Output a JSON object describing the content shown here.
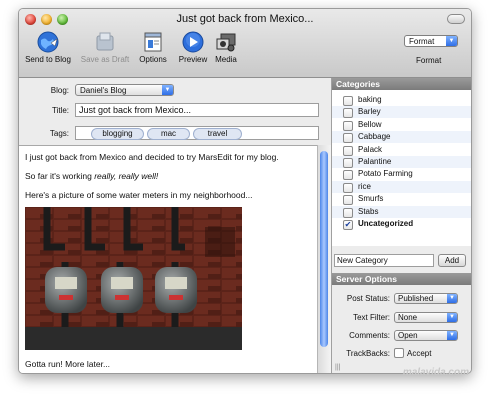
{
  "window": {
    "title": "Just got back from Mexico..."
  },
  "toolbar": {
    "send_label": "Send to Blog",
    "draft_label": "Save as Draft",
    "options_label": "Options",
    "preview_label": "Preview",
    "media_label": "Media",
    "format_value": "Format",
    "format_label": "Format"
  },
  "fields": {
    "blog_label": "Blog:",
    "blog_value": "Daniel's Blog",
    "title_label": "Title:",
    "title_value": "Just got back from Mexico...",
    "tags_label": "Tags:",
    "tags": [
      "blogging",
      "mac",
      "travel"
    ]
  },
  "body": {
    "line1": "I just got back from Mexico and decided to try MarsEdit for my blog.",
    "line2_prefix": "So far it's working ",
    "line2_italic": "really, really well!",
    "line3": "Here's a picture of some water meters in my neighborhood...",
    "line4": "Gotta run! More later..."
  },
  "categories": {
    "header": "Categories",
    "items": [
      {
        "label": "baking",
        "checked": false
      },
      {
        "label": "Barley",
        "checked": false
      },
      {
        "label": "Bellow",
        "checked": false
      },
      {
        "label": "Cabbage",
        "checked": false
      },
      {
        "label": "Palack",
        "checked": false
      },
      {
        "label": "Palantine",
        "checked": false
      },
      {
        "label": "Potato Farming",
        "checked": false
      },
      {
        "label": "rice",
        "checked": false
      },
      {
        "label": "Smurfs",
        "checked": false
      },
      {
        "label": "Stabs",
        "checked": false
      },
      {
        "label": "Uncategorized",
        "checked": true
      }
    ],
    "new_category_value": "New Category",
    "add_label": "Add"
  },
  "server_options": {
    "header": "Server Options",
    "post_status_label": "Post Status:",
    "post_status_value": "Published",
    "text_filter_label": "Text Filter:",
    "text_filter_value": "None",
    "comments_label": "Comments:",
    "comments_value": "Open",
    "trackbacks_label": "TrackBacks:",
    "trackbacks_accept_label": "Accept"
  },
  "watermark": "malavida.com",
  "colors": {
    "accent": "#2f6ee6",
    "panel_header": "#8a8a8a"
  }
}
